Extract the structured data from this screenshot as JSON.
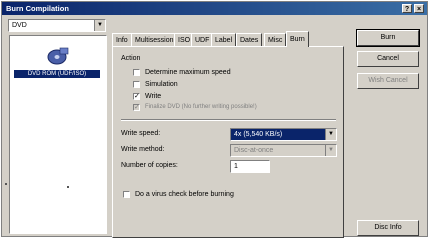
{
  "window": {
    "title": "Burn Compilation",
    "help_glyph": "?",
    "close_glyph": "×"
  },
  "device": {
    "selected": "DVD"
  },
  "compilation": {
    "label": "DVD ROM (UDF/ISO)"
  },
  "tabs": [
    "Info",
    "Multisession",
    "ISO",
    "UDF",
    "Label",
    "Dates",
    "Misc",
    "Burn"
  ],
  "active_tab": "Burn",
  "action": {
    "heading": "Action",
    "options": [
      {
        "label": "Determine maximum speed",
        "checked": false,
        "enabled": true
      },
      {
        "label": "Simulation",
        "checked": false,
        "enabled": true
      },
      {
        "label": "Write",
        "checked": true,
        "enabled": true
      },
      {
        "label": "Finalize DVD (No further writing possible!)",
        "checked": true,
        "enabled": false
      }
    ]
  },
  "settings": {
    "write_speed_label": "Write speed:",
    "write_speed_value": "4x (5,540 KB/s)",
    "write_method_label": "Write method:",
    "write_method_value": "Disc-at-once",
    "copies_label": "Number of copies:",
    "copies_value": "1",
    "virus_check_label": "Do a virus check before burning",
    "virus_check_checked": false
  },
  "buttons": {
    "burn": "Burn",
    "cancel": "Cancel",
    "wish_cancel": "Wish Cancel",
    "disc_info": "Disc Info"
  },
  "colors": {
    "title_bar": "#0a246a",
    "dialog_bg": "#d4d0c8",
    "selection": "#0a246a"
  }
}
